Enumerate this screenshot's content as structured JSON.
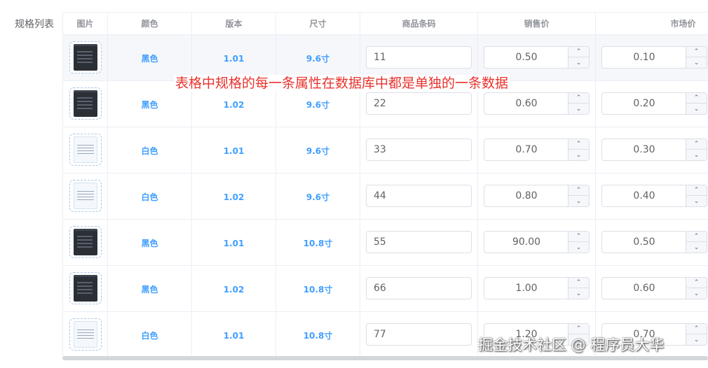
{
  "form": {
    "label": "规格列表"
  },
  "table": {
    "headers": [
      "图片",
      "颜色",
      "版本",
      "尺寸",
      "商品条码",
      "销售价",
      "市场价"
    ],
    "rows": [
      {
        "image": "dark-screenshot",
        "color": "黑色",
        "version": "1.01",
        "size": "9.6寸",
        "barcode": "11",
        "sale_price": "0.50",
        "market_price": "0.10"
      },
      {
        "image": "dark-screenshot",
        "color": "黑色",
        "version": "1.02",
        "size": "9.6寸",
        "barcode": "22",
        "sale_price": "0.60",
        "market_price": "0.20"
      },
      {
        "image": "light-screenshot",
        "color": "白色",
        "version": "1.01",
        "size": "9.6寸",
        "barcode": "33",
        "sale_price": "0.70",
        "market_price": "0.30"
      },
      {
        "image": "light-screenshot",
        "color": "白色",
        "version": "1.02",
        "size": "9.6寸",
        "barcode": "44",
        "sale_price": "0.80",
        "market_price": "0.40"
      },
      {
        "image": "dark-screenshot",
        "color": "黑色",
        "version": "1.01",
        "size": "10.8寸",
        "barcode": "55",
        "sale_price": "90.00",
        "market_price": "0.50"
      },
      {
        "image": "dark-screenshot",
        "color": "黑色",
        "version": "1.02",
        "size": "10.8寸",
        "barcode": "66",
        "sale_price": "1.00",
        "market_price": "0.60"
      },
      {
        "image": "light-screenshot",
        "color": "白色",
        "version": "1.01",
        "size": "10.8寸",
        "barcode": "77",
        "sale_price": "1.20",
        "market_price": "0.70"
      }
    ]
  },
  "annotation": "表格中规格的每一条属性在数据库中都是单独的一条数据",
  "watermark": "掘金技术社区 @ 程序员大华",
  "icons": {
    "increase": "chevron-up-icon",
    "decrease": "chevron-down-icon"
  },
  "colors": {
    "accent": "#409eff",
    "annotation": "#e8322d",
    "border": "#ebeef5"
  }
}
